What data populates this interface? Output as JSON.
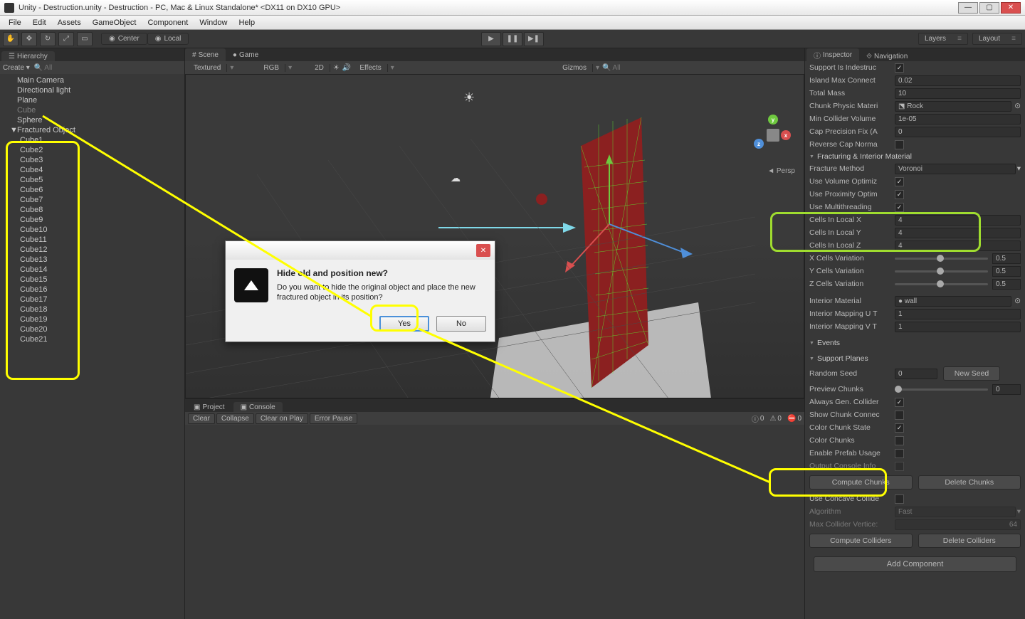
{
  "window": {
    "title": "Unity - Destruction.unity - Destruction - PC, Mac & Linux Standalone* <DX11 on DX10 GPU>"
  },
  "menu": [
    "File",
    "Edit",
    "Assets",
    "GameObject",
    "Component",
    "Window",
    "Help"
  ],
  "toolbar": {
    "pivot_center": "Center",
    "pivot_local": "Local",
    "layers": "Layers",
    "layout": "Layout"
  },
  "hierarchy": {
    "tab": "Hierarchy",
    "create": "Create",
    "search_placeholder": "All",
    "items": [
      {
        "name": "Main Camera"
      },
      {
        "name": "Directional light"
      },
      {
        "name": "Plane"
      },
      {
        "name": "Cube",
        "grey": true
      },
      {
        "name": "Sphere"
      },
      {
        "name": "Fractured Object",
        "expanded": true
      }
    ],
    "children": [
      "Cube1",
      "Cube2",
      "Cube3",
      "Cube4",
      "Cube5",
      "Cube6",
      "Cube7",
      "Cube8",
      "Cube9",
      "Cube10",
      "Cube11",
      "Cube12",
      "Cube13",
      "Cube14",
      "Cube15",
      "Cube16",
      "Cube17",
      "Cube18",
      "Cube19",
      "Cube20",
      "Cube21"
    ]
  },
  "scene": {
    "tabs": {
      "scene": "Scene",
      "game": "Game"
    },
    "shading": "Textured",
    "render": "RGB",
    "twod": "2D",
    "effects": "Effects",
    "gizmos": "Gizmos",
    "search_placeholder": "All",
    "persp": "Persp"
  },
  "bottom": {
    "tabs": {
      "project": "Project",
      "console": "Console"
    },
    "buttons": [
      "Clear",
      "Collapse",
      "Clear on Play",
      "Error Pause"
    ],
    "stats": {
      "info": "0",
      "warn": "0",
      "error": "0"
    }
  },
  "inspector": {
    "tabs": {
      "inspector": "Inspector",
      "navigation": "Navigation"
    },
    "rows": {
      "support": "Support Is Indestruc",
      "island": "Island Max Connect",
      "island_v": "0.02",
      "mass": "Total Mass",
      "mass_v": "10",
      "physmat": "Chunk Physic Materi",
      "physmat_v": "Rock",
      "mincol": "Min Collider Volume",
      "mincol_v": "1e-05",
      "capprec": "Cap Precision Fix (A",
      "capprec_v": "0",
      "revcap": "Reverse Cap Norma"
    },
    "frac_header": "Fracturing & Interior Material",
    "frac": {
      "method": "Fracture Method",
      "method_v": "Voronoi",
      "usevol": "Use Volume Optimiz",
      "useprox": "Use Proximity Optim",
      "usemt": "Use Multithreading",
      "cx": "Cells In Local X",
      "cx_v": "4",
      "cy": "Cells In Local Y",
      "cy_v": "4",
      "cz": "Cells In Local Z",
      "cz_v": "4",
      "xvar": "X Cells Variation",
      "xvar_v": "0.5",
      "yvar": "Y Cells Variation",
      "yvar_v": "0.5",
      "zvar": "Z Cells Variation",
      "zvar_v": "0.5",
      "intmat": "Interior Material",
      "intmat_v": "wall",
      "mapu": "Interior Mapping U T",
      "mapu_v": "1",
      "mapv": "Interior Mapping V T",
      "mapv_v": "1"
    },
    "events": "Events",
    "planes": "Support Planes",
    "sup": {
      "seed": "Random Seed",
      "seed_v": "0",
      "newseed": "New Seed",
      "preview": "Preview Chunks",
      "preview_v": "0",
      "always": "Always Gen. Collider",
      "showconn": "Show Chunk Connec",
      "colorstate": "Color Chunk State",
      "colorchunks": "Color Chunks",
      "prefab": "Enable Prefab Usage",
      "output": "Output Console Info"
    },
    "compute": "Compute Chunks",
    "delete": "Delete Chunks",
    "concave": "Use Concave Collide",
    "algo": "Algorithm",
    "algo_v": "Fast",
    "maxvert": "Max Collider Vertice:",
    "maxvert_v": "64",
    "compcol": "Compute Colliders",
    "delcol": "Delete Colliders",
    "addcomp": "Add Component"
  },
  "dialog": {
    "title": "Hide old and position new?",
    "body": "Do you want to hide the original object and place the new fractured object in its position?",
    "yes": "Yes",
    "no": "No"
  }
}
